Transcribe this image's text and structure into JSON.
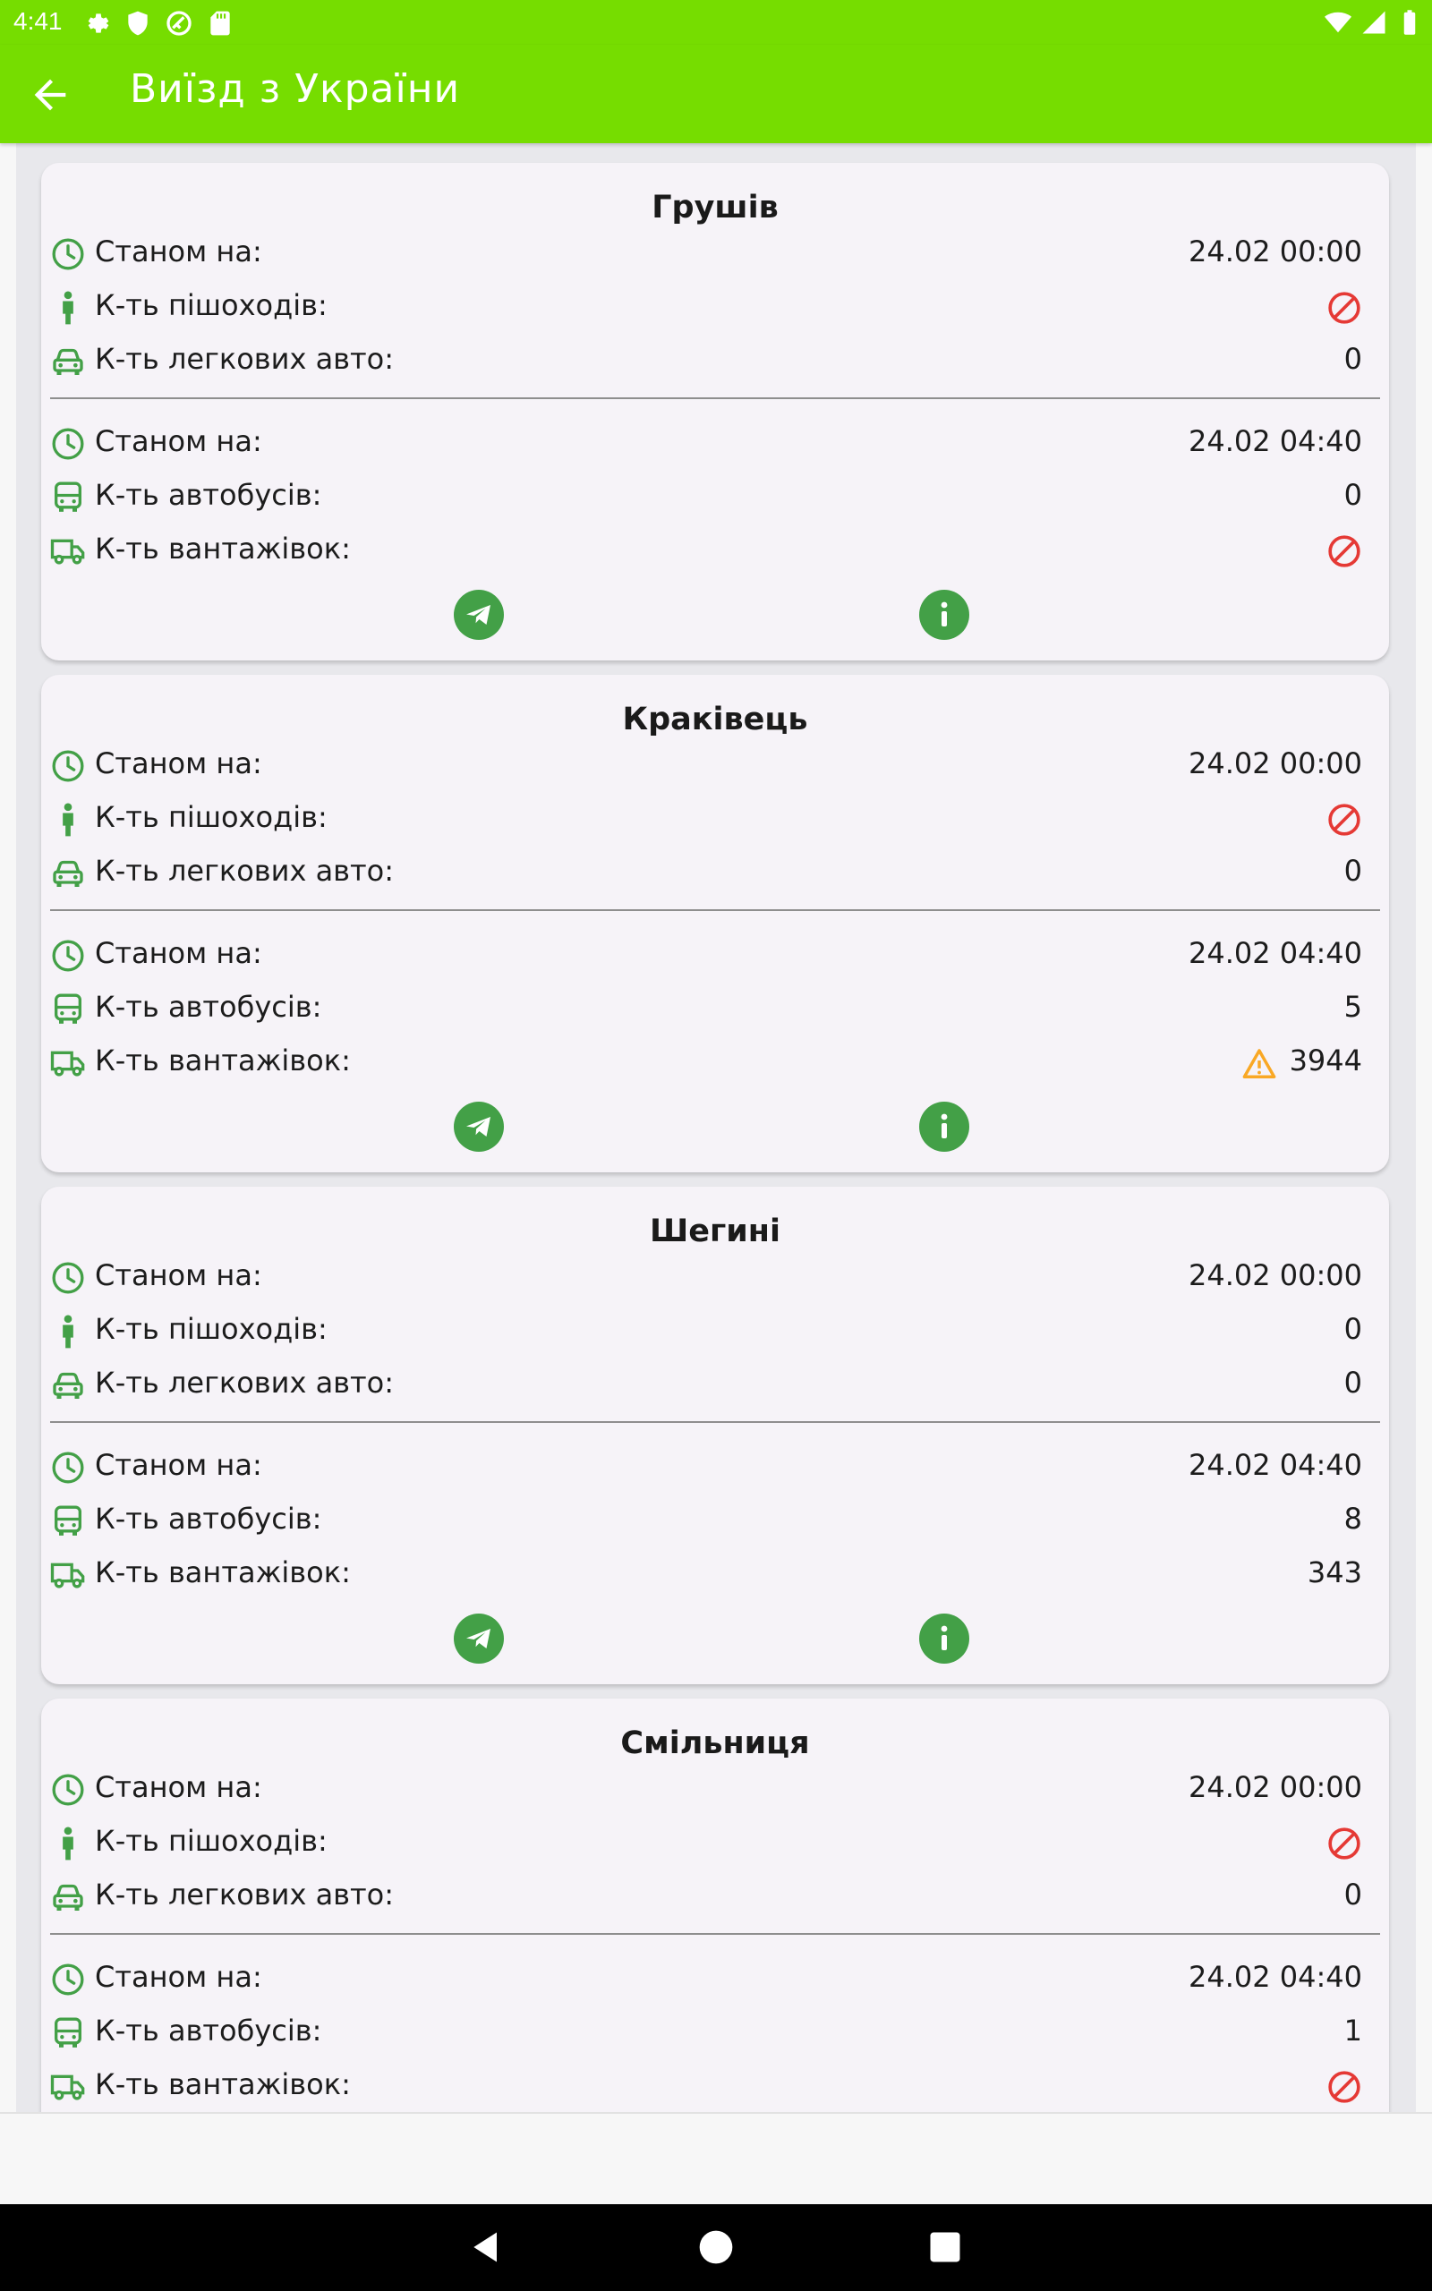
{
  "status": {
    "time": "4:41"
  },
  "appbar": {
    "title": "Виїзд з України"
  },
  "labels": {
    "as_of": "Станом на:",
    "pedestrians": "К-ть пішоходів:",
    "cars": "К-ть легкових авто:",
    "buses": "К-ть автобусів:",
    "trucks": "К-ть вантажівок:"
  },
  "colors": {
    "accent": "#76dd00",
    "icon_green": "#43a047",
    "closed_red": "#e53935",
    "warning_orange": "#f9a825"
  },
  "cards": [
    {
      "name": "Грушів",
      "as_of_1": "24.02 00:00",
      "pedestrians": {
        "status": "closed",
        "value": ""
      },
      "cars": {
        "status": "value",
        "value": "0"
      },
      "as_of_2": "24.02 04:40",
      "buses": {
        "status": "value",
        "value": "0"
      },
      "trucks": {
        "status": "closed",
        "value": ""
      }
    },
    {
      "name": "Краківець",
      "as_of_1": "24.02 00:00",
      "pedestrians": {
        "status": "closed",
        "value": ""
      },
      "cars": {
        "status": "value",
        "value": "0"
      },
      "as_of_2": "24.02 04:40",
      "buses": {
        "status": "value",
        "value": "5"
      },
      "trucks": {
        "status": "warning",
        "value": "3944"
      }
    },
    {
      "name": "Шегині",
      "as_of_1": "24.02 00:00",
      "pedestrians": {
        "status": "value",
        "value": "0"
      },
      "cars": {
        "status": "value",
        "value": "0"
      },
      "as_of_2": "24.02 04:40",
      "buses": {
        "status": "value",
        "value": "8"
      },
      "trucks": {
        "status": "value",
        "value": "343"
      }
    },
    {
      "name": "Смільниця",
      "as_of_1": "24.02 00:00",
      "pedestrians": {
        "status": "closed",
        "value": ""
      },
      "cars": {
        "status": "value",
        "value": "0"
      },
      "as_of_2": "24.02 04:40",
      "buses": {
        "status": "value",
        "value": "1"
      },
      "trucks": {
        "status": "closed",
        "value": ""
      }
    }
  ]
}
